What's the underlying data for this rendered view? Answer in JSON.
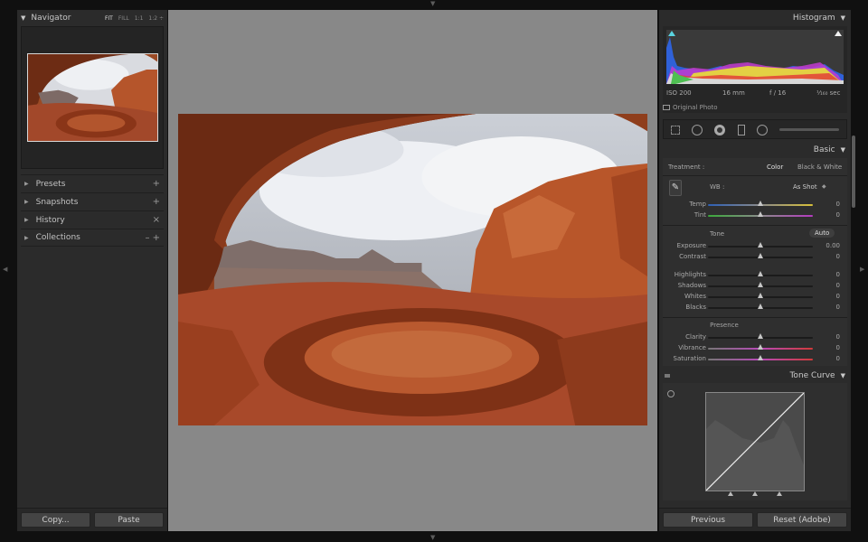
{
  "navigator": {
    "title": "Navigator",
    "zoom_options": [
      "FIT",
      "FILL",
      "1:1",
      "1:2 ÷"
    ]
  },
  "left_panels": [
    {
      "label": "Presets",
      "action": "+"
    },
    {
      "label": "Snapshots",
      "action": "+"
    },
    {
      "label": "History",
      "action": "×"
    },
    {
      "label": "Collections",
      "action": "– +"
    }
  ],
  "left_buttons": {
    "copy": "Copy...",
    "paste": "Paste"
  },
  "histogram": {
    "title": "Histogram",
    "iso": "ISO 200",
    "focal": "16 mm",
    "aperture": "f / 16",
    "shutter": "¹⁄₁₆₀ sec",
    "original": "Original Photo"
  },
  "basic": {
    "title": "Basic",
    "treatment_label": "Treatment :",
    "treatment_color": "Color",
    "treatment_bw": "Black & White",
    "wb_label": "WB :",
    "wb_value": "As Shot",
    "tone_label": "Tone",
    "auto_label": "Auto",
    "presence_label": "Presence",
    "sliders": {
      "temp": {
        "label": "Temp",
        "value": "0",
        "pos": 0.5
      },
      "tint": {
        "label": "Tint",
        "value": "0",
        "pos": 0.5
      },
      "exposure": {
        "label": "Exposure",
        "value": "0.00",
        "pos": 0.5
      },
      "contrast": {
        "label": "Contrast",
        "value": "0",
        "pos": 0.5
      },
      "highlights": {
        "label": "Highlights",
        "value": "0",
        "pos": 0.5
      },
      "shadows": {
        "label": "Shadows",
        "value": "0",
        "pos": 0.5
      },
      "whites": {
        "label": "Whites",
        "value": "0",
        "pos": 0.5
      },
      "blacks": {
        "label": "Blacks",
        "value": "0",
        "pos": 0.5
      },
      "clarity": {
        "label": "Clarity",
        "value": "0",
        "pos": 0.5
      },
      "vibrance": {
        "label": "Vibrance",
        "value": "0",
        "pos": 0.5
      },
      "saturation": {
        "label": "Saturation",
        "value": "0",
        "pos": 0.5
      }
    }
  },
  "tone_curve": {
    "title": "Tone Curve"
  },
  "right_buttons": {
    "previous": "Previous",
    "reset": "Reset (Adobe)"
  },
  "colors": {
    "panel": "#2b2b2b",
    "center": "#888888",
    "accent": "#e2e2e2"
  }
}
